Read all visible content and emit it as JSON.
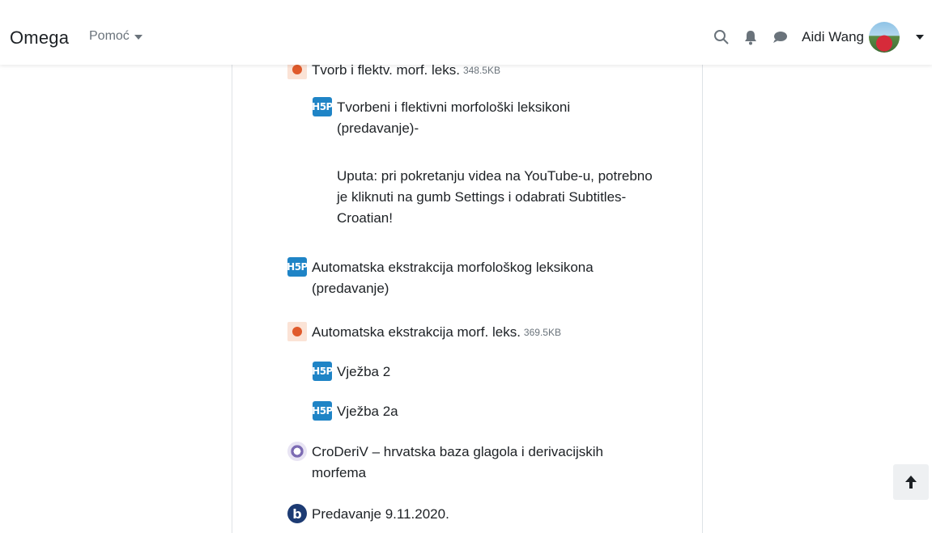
{
  "navbar": {
    "brand": "Omega",
    "help_label": "Pomoć",
    "user_name": "Aidi Wang"
  },
  "icons": {
    "search": "search-icon",
    "bell": "bell-icon",
    "chat": "chat-icon",
    "back_to_top": "arrow-up-icon"
  },
  "colors": {
    "h5p_blue": "#1f84c6",
    "text": "#1d2125",
    "muted": "#6a737b"
  },
  "activities": [
    {
      "type": "ppt",
      "label": "Tvorb i flektv. morf. leks.",
      "size": "348.5KB"
    },
    {
      "type": "h5p",
      "label": "Tvorbeni i flektivni morfološki leksikoni (predavanje)-",
      "description": "Uputa: pri pokretanju videa na YouTube-u, potrebno je kliknuti na gumb Settings i odabrati Subtitles-Croatian!"
    },
    {
      "type": "h5p",
      "label": "Automatska ekstrakcija morfološkog leksikona (predavanje)"
    },
    {
      "type": "ppt",
      "label": "Automatska ekstrakcija morf. leks.",
      "size": "369.5KB"
    },
    {
      "type": "h5p",
      "label": "Vježba 2"
    },
    {
      "type": "h5p",
      "label": "Vježba 2a"
    },
    {
      "type": "url",
      "label": "CroDeriV – hrvatska baza glagola i derivacijskih morfema"
    },
    {
      "type": "bbb",
      "label": "Predavanje 9.11.2020."
    }
  ]
}
